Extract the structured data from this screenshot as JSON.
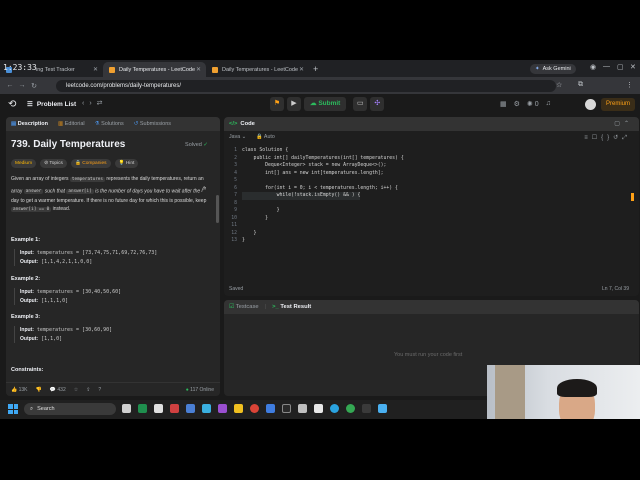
{
  "browser": {
    "clock": "1:23:33",
    "tabs": [
      {
        "label": "ing Test Tracker"
      },
      {
        "label": "Daily Temperatures - LeetCode"
      },
      {
        "label": "Daily Temperatures - LeetCode"
      }
    ],
    "new_tab": "+",
    "ask_gemini": "Ask Gemini",
    "url": "leetcode.com/problems/daily-temperatures/"
  },
  "header": {
    "problem_list": "Problem List",
    "submit": "Submit",
    "premium": "Premium",
    "streak": "0"
  },
  "description": {
    "tabs": [
      "Description",
      "Editorial",
      "Solutions",
      "Submissions"
    ],
    "title": "739. Daily Temperatures",
    "solved": "Solved",
    "tags": [
      "Medium",
      "Topics",
      "Companies",
      "Hint"
    ],
    "para1": "Given an array of integers",
    "chip_temps": "temperatures",
    "para2": "represents the daily temperatures, return an array",
    "chip_answer": "answer",
    "para3": "such that",
    "chip_answer_i": "answer[i]",
    "para4": "is the number of days you have to wait after the",
    "ith": "i",
    "th": "th",
    "para5": "day to get a warmer temperature. If there is no future day for which this is possible, keep",
    "chip_zero": "answer[i] == 0",
    "para6": "instead.",
    "examples": [
      {
        "heading": "Example 1:",
        "input": "temperatures = [73,74,75,71,69,72,76,73]",
        "output": "[1,1,4,2,1,1,0,0]"
      },
      {
        "heading": "Example 2:",
        "input": "temperatures = [30,40,50,60]",
        "output": "[1,1,1,0]"
      },
      {
        "heading": "Example 3:",
        "input": "temperatures = [30,60,90]",
        "output": "[1,1,0]"
      }
    ],
    "input_label": "Input:",
    "output_label": "Output:",
    "constraints": "Constraints:",
    "likes": "13K",
    "comments": "432",
    "online": "117 Online"
  },
  "code": {
    "title": "Code",
    "language": "Java",
    "auto": "Auto",
    "lines": [
      "class Solution {",
      "    public int[] dailyTemperatures(int[] temperatures) {",
      "        Deque<Integer> stack = new ArrayDeque<>();",
      "        int[] ans = new int[temperatures.length];",
      "",
      "        for(int i = 0; i < temperatures.length; i++) {",
      "            while(!stack.isEmpty() && ) {",
      "",
      "            }",
      "        }",
      "",
      "    }",
      "}"
    ],
    "line_numbers": [
      "1",
      "2",
      "3",
      "4",
      "5",
      "6",
      "7",
      "8",
      "9",
      "10",
      "11",
      "12",
      "13"
    ],
    "saved": "Saved",
    "position": "Ln 7, Col 39"
  },
  "test": {
    "tabs": [
      "Testcase",
      "Test Result"
    ],
    "empty_msg": "You must run your code first"
  },
  "taskbar": {
    "search": "Search"
  }
}
